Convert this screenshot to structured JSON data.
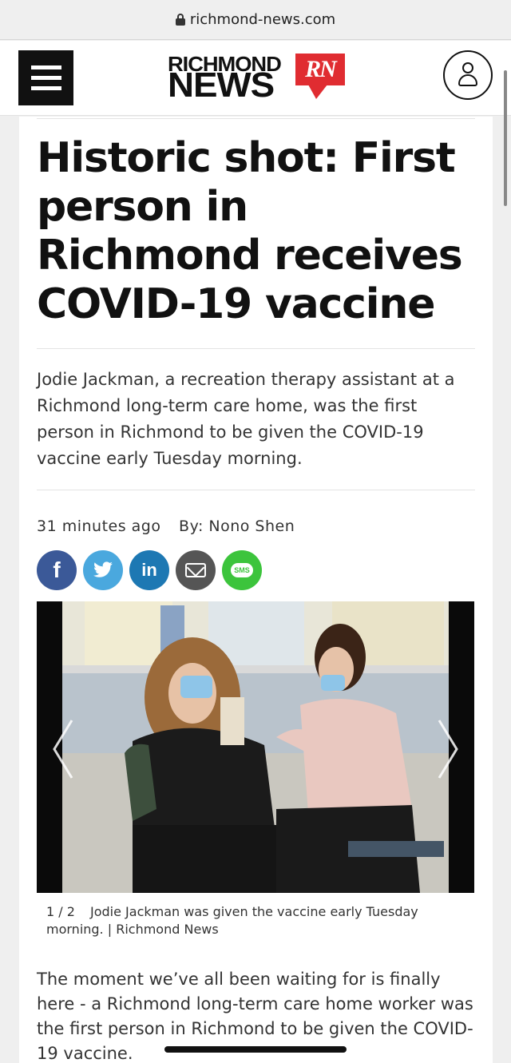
{
  "browser": {
    "url": "richmond-news.com"
  },
  "header": {
    "logo_line1": "RICHMOND",
    "logo_line2": "NEWS",
    "logo_badge": "RN"
  },
  "article": {
    "title": "Historic shot: First person in Richmond receives COVID-19 vaccine",
    "summary": "Jodie Jackman, a recreation therapy assistant at a Richmond long-term care home, was the first person in Richmond to be given the COVID-19 vaccine early Tuesday morning.",
    "time": "31 minutes ago",
    "byline": "By: Nono Shen",
    "share": {
      "facebook": "f",
      "linkedin": "in",
      "sms": "SMS"
    },
    "gallery": {
      "counter": "1 / 2",
      "caption": "Jodie Jackman was given the vaccine early Tuesday morning.",
      "credit": "| Richmond News"
    },
    "body": "The moment we’ve all been waiting for is finally here - a Richmond long-term care home worker was the first person in Richmond to be given the COVID-19 vaccine."
  },
  "colors": {
    "brand_red": "#e02c31",
    "facebook": "#3b5998",
    "twitter": "#4aa8de",
    "linkedin": "#1d78b3",
    "email": "#555555",
    "sms": "#3cc43c"
  }
}
